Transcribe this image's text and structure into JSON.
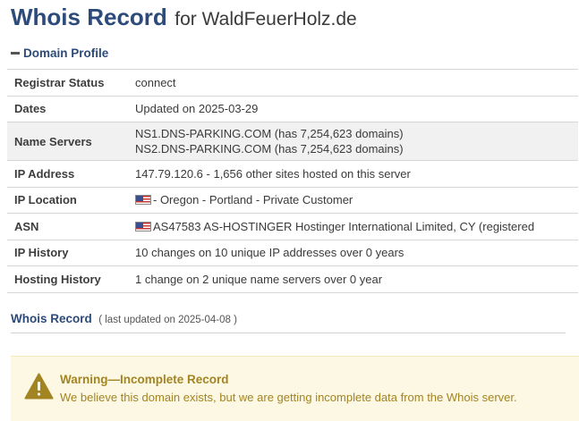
{
  "header": {
    "title": "Whois Record",
    "for_prefix": "for",
    "domain": "WaldFeuerHolz.de"
  },
  "profile": {
    "section_title": "Domain Profile",
    "registrar_status": {
      "label": "Registrar Status",
      "value": "connect"
    },
    "dates": {
      "label": "Dates",
      "value": "Updated on 2025-03-29"
    },
    "name_servers": {
      "label": "Name Servers",
      "ns1": "NS1.DNS-PARKING.COM (has 7,254,623 domains)",
      "ns2": "NS2.DNS-PARKING.COM (has 7,254,623 domains)"
    },
    "ip_address": {
      "label": "IP Address",
      "value": "147.79.120.6 - 1,656 other sites hosted on this server"
    },
    "ip_location": {
      "label": "IP Location",
      "flag": "us-flag-icon",
      "value": "- Oregon - Portland - Private Customer"
    },
    "asn": {
      "label": "ASN",
      "flag": "us-flag-icon",
      "value": "AS47583 AS-HOSTINGER Hostinger International Limited, CY (registered"
    },
    "ip_history": {
      "label": "IP History",
      "value": "10 changes on 10 unique IP addresses over 0 years"
    },
    "hosting_history": {
      "label": "Hosting History",
      "value": "1 change on 2 unique name servers over 0 year"
    }
  },
  "whois": {
    "title": "Whois Record",
    "updated": "( last updated on 2025-04-08 )"
  },
  "warning": {
    "icon": "warning-triangle-icon",
    "title": "Warning—Incomplete Record",
    "text": "We believe this domain exists, but we are getting incomplete data from the Whois server."
  },
  "colors": {
    "heading_blue": "#2c4a7a",
    "warning_bg": "#fcf8e3",
    "warning_text": "#a38423"
  }
}
